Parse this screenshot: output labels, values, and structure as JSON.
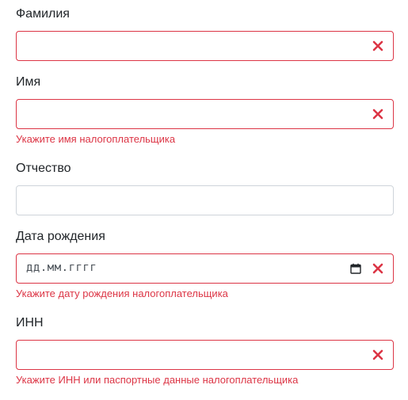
{
  "form": {
    "fields": [
      {
        "label": "Фамилия",
        "value": "",
        "error": ""
      },
      {
        "label": "Имя",
        "value": "",
        "error": "Укажите имя налогоплательщика"
      },
      {
        "label": "Отчество",
        "value": "",
        "error": ""
      },
      {
        "label": "Дата рождения",
        "placeholder": "дд.мм.гггг",
        "error": "Укажите дату рождения налогоплательщика"
      },
      {
        "label": "ИНН",
        "value": "",
        "error": "Укажите ИНН или паспортные данные налогоплательщика"
      }
    ]
  },
  "colors": {
    "error": "#dc3545",
    "text": "#212529",
    "border_normal": "#ced4da"
  },
  "icons": {
    "clear": "clear-icon",
    "calendar": "calendar-icon"
  }
}
